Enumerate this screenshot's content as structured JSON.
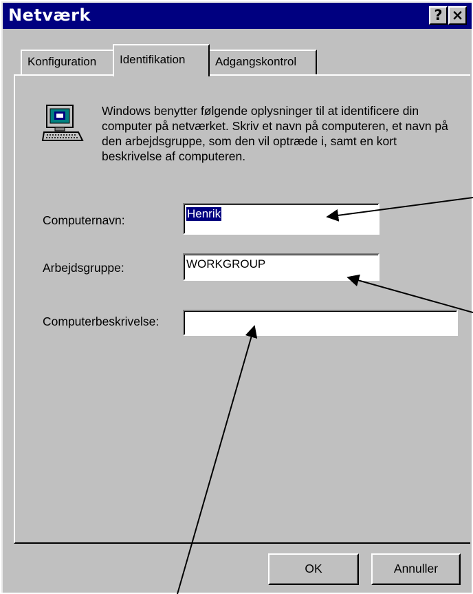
{
  "window": {
    "title": "Netværk",
    "help_button": "?",
    "close_button": "×"
  },
  "tabs": [
    {
      "label": "Konfiguration",
      "active": false
    },
    {
      "label": "Identifikation",
      "active": true
    },
    {
      "label": "Adgangskontrol",
      "active": false
    }
  ],
  "identification": {
    "icon": "computer-network-icon",
    "description": "Windows benytter følgende oplysninger til at identificere din computer på netværket. Skriv et navn på computeren, et navn på den arbejdsgruppe, som den vil optræde i, samt en kort beskrivelse af computeren.",
    "computer_name_label": "Computernavn:",
    "computer_name_value": "Henrik",
    "workgroup_label": "Arbejdsgruppe:",
    "workgroup_value": "WORKGROUP",
    "computer_description_label": "Computerbeskrivelse:",
    "computer_description_value": ""
  },
  "buttons": {
    "ok_label": "OK",
    "cancel_label": "Annuller"
  },
  "colors": {
    "titlebar": "#000080",
    "face": "#c0c0c0",
    "selection": "#000080"
  }
}
